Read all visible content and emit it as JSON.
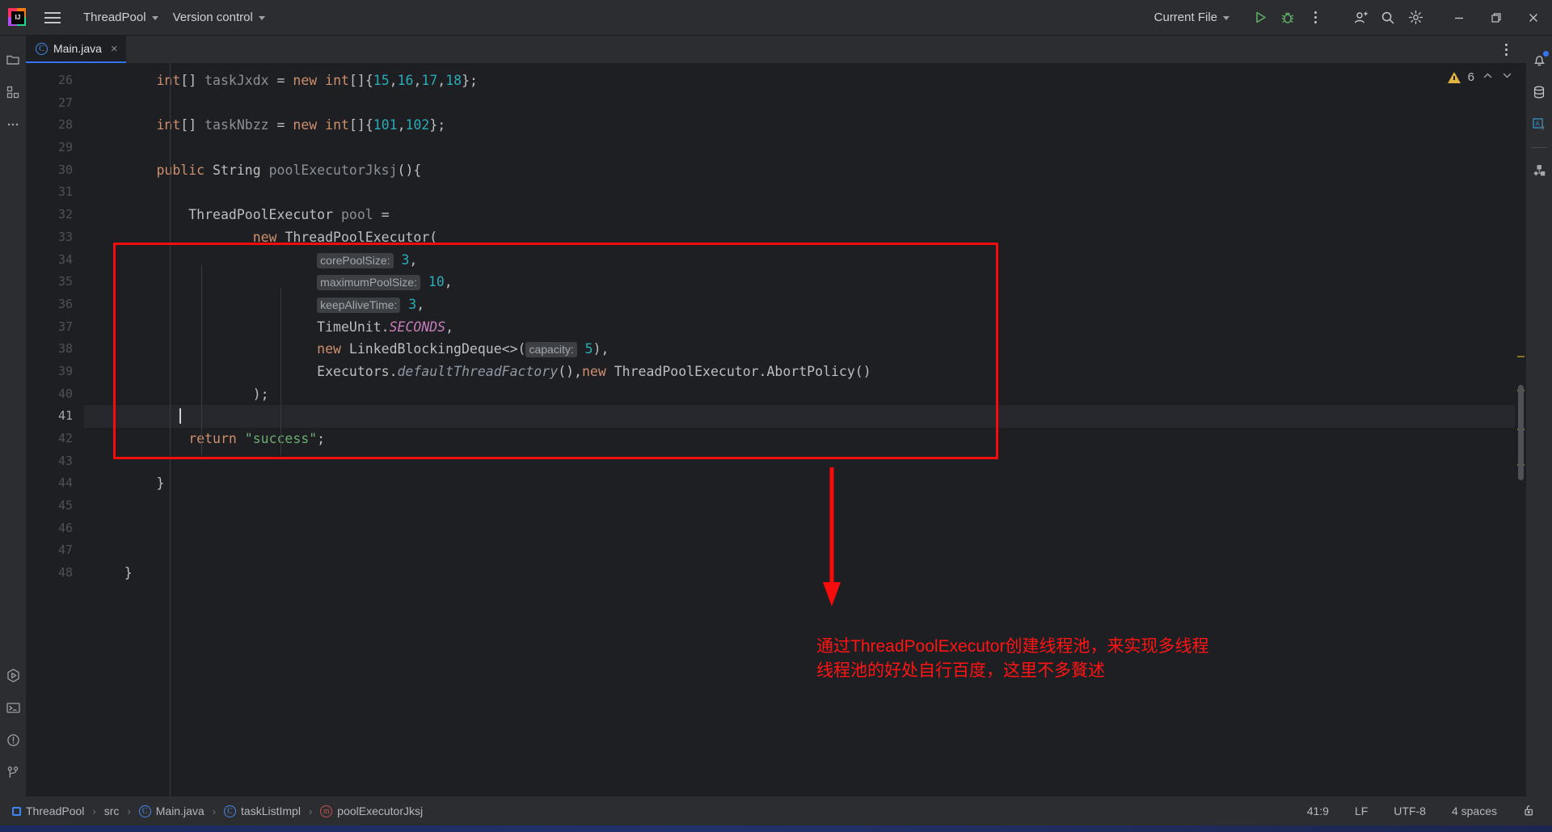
{
  "window": {
    "app_icon": "intellij-logo-icon",
    "menu_icon": "hamburger-menu-icon",
    "project_name": "ThreadPool",
    "vcs_label": "Version control",
    "run_config": "Current File",
    "run_icon": "run-play-icon",
    "debug_icon": "debug-bug-icon",
    "more_icon": "more-vertical-icon",
    "account_icon": "account-user-icon",
    "search_icon": "search-icon",
    "settings_icon": "gear-icon",
    "minimize_icon": "minimize-icon",
    "maximize_icon": "maximize-restore-icon",
    "close_icon": "close-icon"
  },
  "left_sidebar": {
    "items": [
      {
        "name": "project-tool-icon",
        "glyph": "folder"
      },
      {
        "name": "structure-tool-icon",
        "glyph": "blocks"
      },
      {
        "name": "more-tool-windows-icon",
        "glyph": "dots"
      }
    ],
    "bottom_items": [
      {
        "name": "run-tool-icon",
        "glyph": "run-hex"
      },
      {
        "name": "terminal-tool-icon",
        "glyph": "terminal"
      },
      {
        "name": "problems-tool-icon",
        "glyph": "exclaim"
      },
      {
        "name": "git-tool-icon",
        "glyph": "branch"
      }
    ]
  },
  "right_sidebar": {
    "items": [
      {
        "name": "notifications-icon",
        "glyph": "bell",
        "badge": true
      },
      {
        "name": "database-icon",
        "glyph": "db"
      },
      {
        "name": "translation-icon",
        "glyph": "translate"
      },
      {
        "name": "bean-diagram-icon",
        "glyph": "beans"
      }
    ]
  },
  "tabs": {
    "open": [
      {
        "label": "Main.java",
        "icon": "java-class-icon",
        "active": true,
        "close_glyph": "×"
      }
    ],
    "options_icon": "tab-options-icon"
  },
  "inspections": {
    "warning_count": "6",
    "warning_icon": "warning-triangle-icon",
    "prev_icon": "chevron-up-icon",
    "next_icon": "chevron-down-icon"
  },
  "editor": {
    "first_line_number": 26,
    "current_line": 41,
    "lines": [
      {
        "n": 26,
        "tokens": [
          {
            "t": "        ",
            "c": "id"
          },
          {
            "t": "int",
            "c": "kw"
          },
          {
            "t": "[] ",
            "c": "id"
          },
          {
            "t": "taskJxdx",
            "c": "meth-decl"
          },
          {
            "t": " = ",
            "c": "id"
          },
          {
            "t": "new",
            "c": "kw"
          },
          {
            "t": " ",
            "c": "id"
          },
          {
            "t": "int",
            "c": "kw"
          },
          {
            "t": "[]{",
            "c": "id"
          },
          {
            "t": "15",
            "c": "num"
          },
          {
            "t": ",",
            "c": "id"
          },
          {
            "t": "16",
            "c": "num"
          },
          {
            "t": ",",
            "c": "id"
          },
          {
            "t": "17",
            "c": "num"
          },
          {
            "t": ",",
            "c": "id"
          },
          {
            "t": "18",
            "c": "num"
          },
          {
            "t": "};",
            "c": "id"
          }
        ]
      },
      {
        "n": 27,
        "tokens": []
      },
      {
        "n": 28,
        "tokens": [
          {
            "t": "        ",
            "c": "id"
          },
          {
            "t": "int",
            "c": "kw"
          },
          {
            "t": "[] ",
            "c": "id"
          },
          {
            "t": "taskNbzz",
            "c": "meth-decl"
          },
          {
            "t": " = ",
            "c": "id"
          },
          {
            "t": "new",
            "c": "kw"
          },
          {
            "t": " ",
            "c": "id"
          },
          {
            "t": "int",
            "c": "kw"
          },
          {
            "t": "[]{",
            "c": "id"
          },
          {
            "t": "101",
            "c": "num"
          },
          {
            "t": ",",
            "c": "id"
          },
          {
            "t": "102",
            "c": "num"
          },
          {
            "t": "};",
            "c": "id"
          }
        ]
      },
      {
        "n": 29,
        "tokens": []
      },
      {
        "n": 30,
        "tokens": [
          {
            "t": "        ",
            "c": "id"
          },
          {
            "t": "public",
            "c": "kw"
          },
          {
            "t": " ",
            "c": "id"
          },
          {
            "t": "String",
            "c": "typ"
          },
          {
            "t": " ",
            "c": "id"
          },
          {
            "t": "poolExecutorJksj",
            "c": "meth-decl"
          },
          {
            "t": "(){",
            "c": "id"
          }
        ]
      },
      {
        "n": 31,
        "tokens": []
      },
      {
        "n": 32,
        "tokens": [
          {
            "t": "            ",
            "c": "id"
          },
          {
            "t": "ThreadPoolExecutor",
            "c": "typ"
          },
          {
            "t": " ",
            "c": "id"
          },
          {
            "t": "pool",
            "c": "meth-decl"
          },
          {
            "t": " =",
            "c": "id"
          }
        ]
      },
      {
        "n": 33,
        "tokens": [
          {
            "t": "                    ",
            "c": "id"
          },
          {
            "t": "new",
            "c": "kw"
          },
          {
            "t": " ",
            "c": "id"
          },
          {
            "t": "ThreadPoolExecutor",
            "c": "typ"
          },
          {
            "t": "(",
            "c": "id"
          }
        ]
      },
      {
        "n": 34,
        "tokens": [
          {
            "t": "                            ",
            "c": "id"
          },
          {
            "t": "corePoolSize:",
            "c": "hint"
          },
          {
            "t": " ",
            "c": "id"
          },
          {
            "t": "3",
            "c": "num"
          },
          {
            "t": ",",
            "c": "id"
          }
        ]
      },
      {
        "n": 35,
        "tokens": [
          {
            "t": "                            ",
            "c": "id"
          },
          {
            "t": "maximumPoolSize:",
            "c": "hint"
          },
          {
            "t": " ",
            "c": "id"
          },
          {
            "t": "10",
            "c": "num"
          },
          {
            "t": ",",
            "c": "id"
          }
        ]
      },
      {
        "n": 36,
        "tokens": [
          {
            "t": "                            ",
            "c": "id"
          },
          {
            "t": "keepAliveTime:",
            "c": "hint"
          },
          {
            "t": " ",
            "c": "id"
          },
          {
            "t": "3",
            "c": "num"
          },
          {
            "t": ",",
            "c": "id"
          }
        ]
      },
      {
        "n": 37,
        "tokens": [
          {
            "t": "                            ",
            "c": "id"
          },
          {
            "t": "TimeUnit",
            "c": "typ"
          },
          {
            "t": ".",
            "c": "id"
          },
          {
            "t": "SECONDS",
            "c": "stat"
          },
          {
            "t": ",",
            "c": "id"
          }
        ]
      },
      {
        "n": 38,
        "tokens": [
          {
            "t": "                            ",
            "c": "id"
          },
          {
            "t": "new",
            "c": "kw"
          },
          {
            "t": " ",
            "c": "id"
          },
          {
            "t": "LinkedBlockingDeque",
            "c": "typ"
          },
          {
            "t": "<>(",
            "c": "id"
          },
          {
            "t": "capacity:",
            "c": "hint"
          },
          {
            "t": " ",
            "c": "id"
          },
          {
            "t": "5",
            "c": "num"
          },
          {
            "t": "),",
            "c": "id"
          }
        ]
      },
      {
        "n": 39,
        "tokens": [
          {
            "t": "                            ",
            "c": "id"
          },
          {
            "t": "Executors",
            "c": "typ"
          },
          {
            "t": ".",
            "c": "id"
          },
          {
            "t": "defaultThreadFactory",
            "c": "statm"
          },
          {
            "t": "(),",
            "c": "id"
          },
          {
            "t": "new",
            "c": "kw"
          },
          {
            "t": " ",
            "c": "id"
          },
          {
            "t": "ThreadPoolExecutor.AbortPolicy",
            "c": "typ"
          },
          {
            "t": "()",
            "c": "id"
          }
        ]
      },
      {
        "n": 40,
        "tokens": [
          {
            "t": "                    ",
            "c": "id"
          },
          {
            "t": ");",
            "c": "id"
          }
        ]
      },
      {
        "n": 41,
        "tokens": []
      },
      {
        "n": 42,
        "tokens": [
          {
            "t": "            ",
            "c": "id"
          },
          {
            "t": "return",
            "c": "kw"
          },
          {
            "t": " ",
            "c": "id"
          },
          {
            "t": "\"success\"",
            "c": "str"
          },
          {
            "t": ";",
            "c": "id"
          }
        ]
      },
      {
        "n": 43,
        "tokens": []
      },
      {
        "n": 44,
        "tokens": [
          {
            "t": "        }",
            "c": "id"
          }
        ]
      },
      {
        "n": 45,
        "tokens": []
      },
      {
        "n": 46,
        "tokens": []
      },
      {
        "n": 47,
        "tokens": []
      },
      {
        "n": 48,
        "tokens": [
          {
            "t": "    }",
            "c": "id"
          }
        ]
      }
    ]
  },
  "annotation": {
    "color": "#ff1414",
    "line1": "通过ThreadPoolExecutor创建线程池，来实现多线程",
    "line2": "线程池的好处自行百度，这里不多贅述"
  },
  "statusbar": {
    "breadcrumbs": [
      {
        "label": "ThreadPool",
        "icon": "module-square-icon"
      },
      {
        "label": "src",
        "icon": "none"
      },
      {
        "label": "Main.java",
        "icon": "java-class-icon"
      },
      {
        "label": "taskListImpl",
        "icon": "java-class-icon"
      },
      {
        "label": "poolExecutorJksj",
        "icon": "java-method-icon"
      }
    ],
    "separator": "›",
    "caret_position": "41:9",
    "line_separator": "LF",
    "encoding": "UTF-8",
    "indent": "4 spaces",
    "lock_icon": "unlocked-padlock-icon"
  }
}
